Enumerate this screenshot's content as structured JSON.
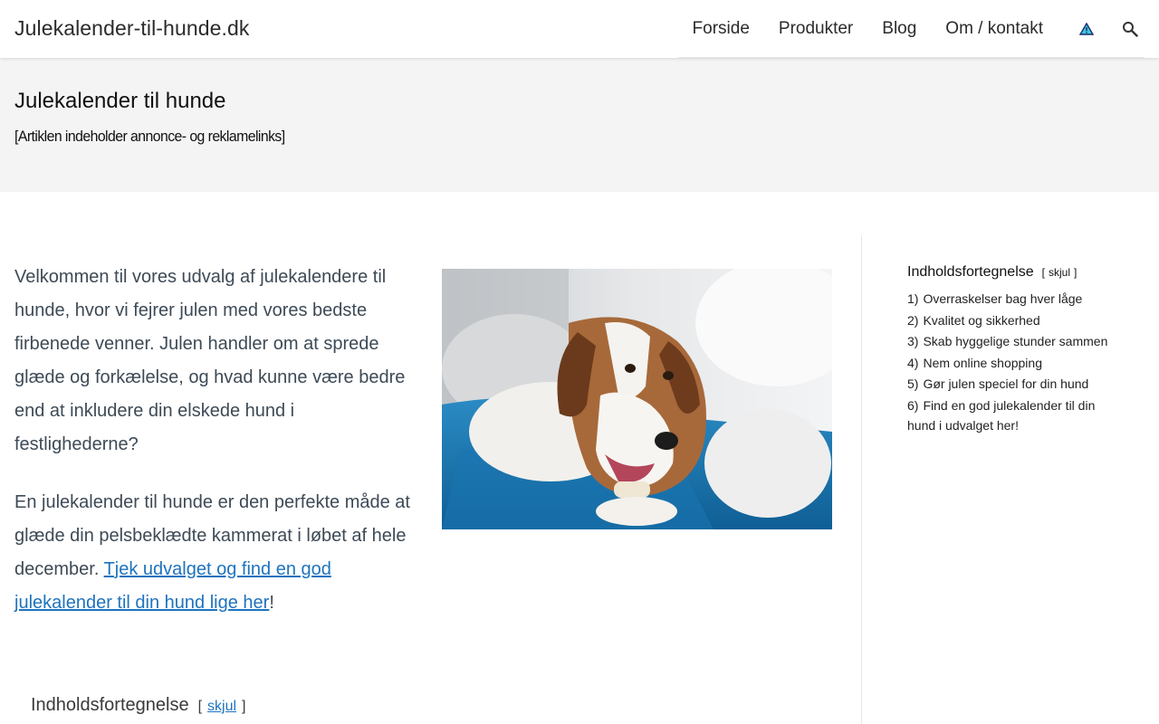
{
  "header": {
    "site_title": "Julekalender-til-hunde.dk",
    "nav": [
      "Forside",
      "Produkter",
      "Blog",
      "Om / kontakt"
    ],
    "icons": [
      "warning-triangle-icon",
      "search-icon"
    ]
  },
  "hero": {
    "title": "Julekalender til hunde",
    "disclaimer": "[Artiklen indeholder annonce- og reklamelinks]"
  },
  "main": {
    "paragraph1": "Velkommen til vores udvalg af julekalendere til hunde, hvor vi fejrer julen med vores bedste firbenede venner. Julen handler om at sprede glæde og forkælelse, og hvad kunne være bedre end at inkludere din elskede hund i festlighederne?",
    "paragraph2_text": "En julekalender til hunde er den perfekte måde at glæde din pelsbeklædte kammerat i løbet af hele december. ",
    "paragraph2_link": "Tjek udvalget og find en god julekalender til din hund lige her",
    "paragraph2_end": "!",
    "image_alt": "Beagle chewing a treat on a blue blanket"
  },
  "sidebar": {
    "toc_title": "Indholdsfortegnelse",
    "toc_toggle": "skjul",
    "items": [
      {
        "num": "1)",
        "label": "Overraskelser bag hver låge"
      },
      {
        "num": "2)",
        "label": "Kvalitet og sikkerhed"
      },
      {
        "num": "3)",
        "label": "Skab hyggelige stunder sammen"
      },
      {
        "num": "4)",
        "label": "Nem online shopping"
      },
      {
        "num": "5)",
        "label": "Gør julen speciel for din hund"
      },
      {
        "num": "6)",
        "label": "Find en god julekalender til din hund i udvalget her!"
      }
    ]
  },
  "bottom_toc": {
    "title": "Indholdsfortegnelse",
    "toggle": "skjul"
  },
  "colors": {
    "link": "#1e73be",
    "hero_bg": "#f4f4f4",
    "body_text": "#3d4a56"
  }
}
